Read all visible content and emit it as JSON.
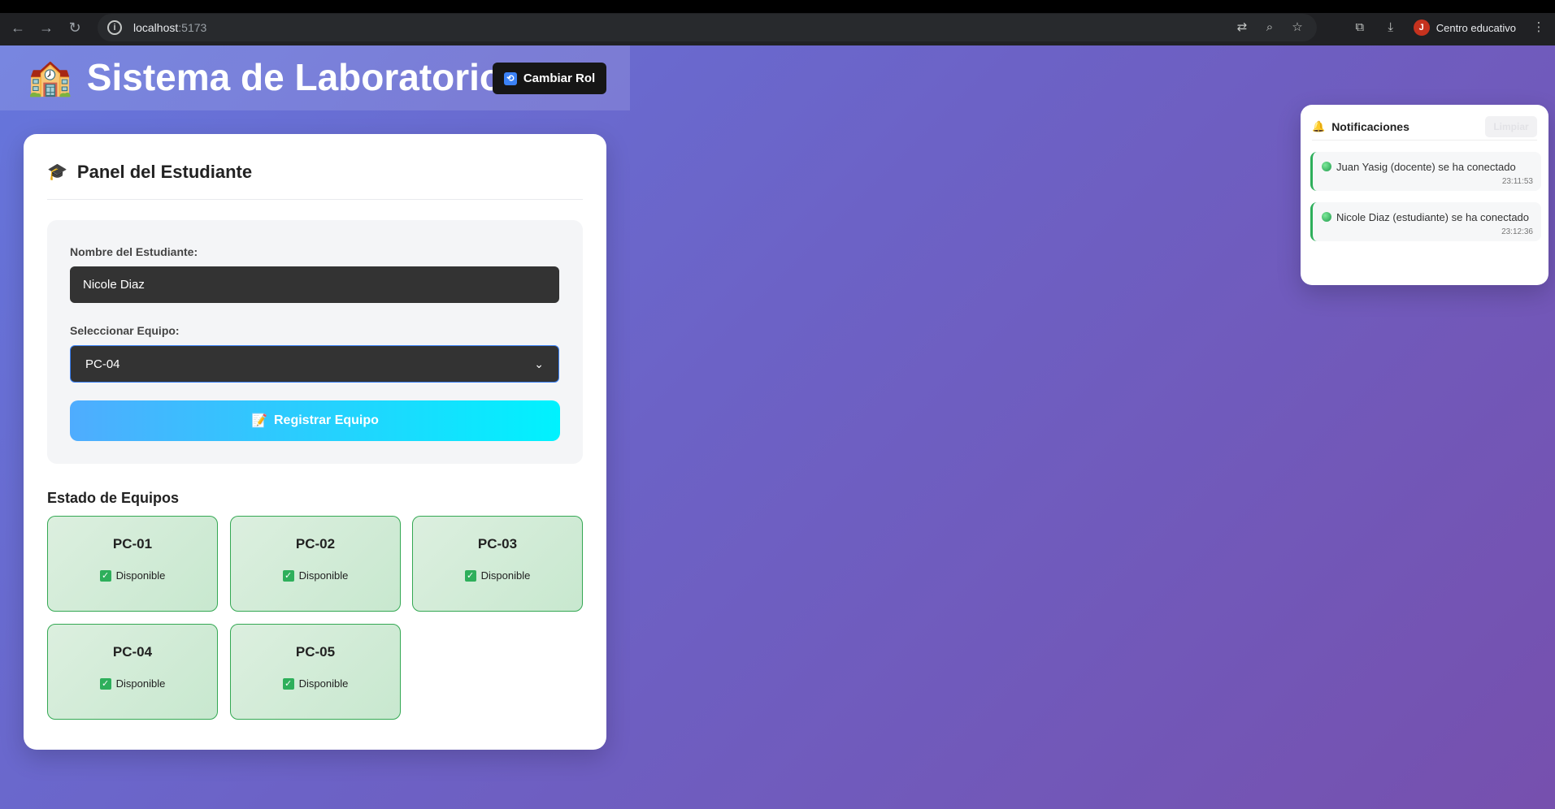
{
  "browser": {
    "url_host": "localhost",
    "url_port": ":5173",
    "profile_initial": "J",
    "profile_name": "Centro educativo"
  },
  "header": {
    "title": "Sistema de Laboratorio",
    "icon": "school-icon",
    "role_button_label": "Cambiar Rol"
  },
  "panel": {
    "title": "Panel del Estudiante",
    "name_label": "Nombre del Estudiante:",
    "name_value": "Nicole Diaz",
    "equipment_label": "Seleccionar Equipo:",
    "equipment_selected": "PC-04",
    "register_button": "Registrar Equipo",
    "status_title": "Estado de Equipos",
    "equipment": [
      {
        "name": "PC-01",
        "status": "Disponible"
      },
      {
        "name": "PC-02",
        "status": "Disponible"
      },
      {
        "name": "PC-03",
        "status": "Disponible"
      },
      {
        "name": "PC-04",
        "status": "Disponible"
      },
      {
        "name": "PC-05",
        "status": "Disponible"
      }
    ]
  },
  "notifications": {
    "title": "Notificaciones",
    "clear_label": "Limpiar",
    "items": [
      {
        "message": "Juan Yasig (docente) se ha conectado",
        "time": "23:11:53"
      },
      {
        "message": "Nicole Diaz (estudiante) se ha conectado",
        "time": "23:12:36"
      }
    ]
  },
  "colors": {
    "accent_green": "#2eaf5b",
    "button_gradient_start": "#4facfe",
    "button_gradient_end": "#00f2fe",
    "background_start": "#6676dc",
    "background_end": "#7650ae"
  }
}
